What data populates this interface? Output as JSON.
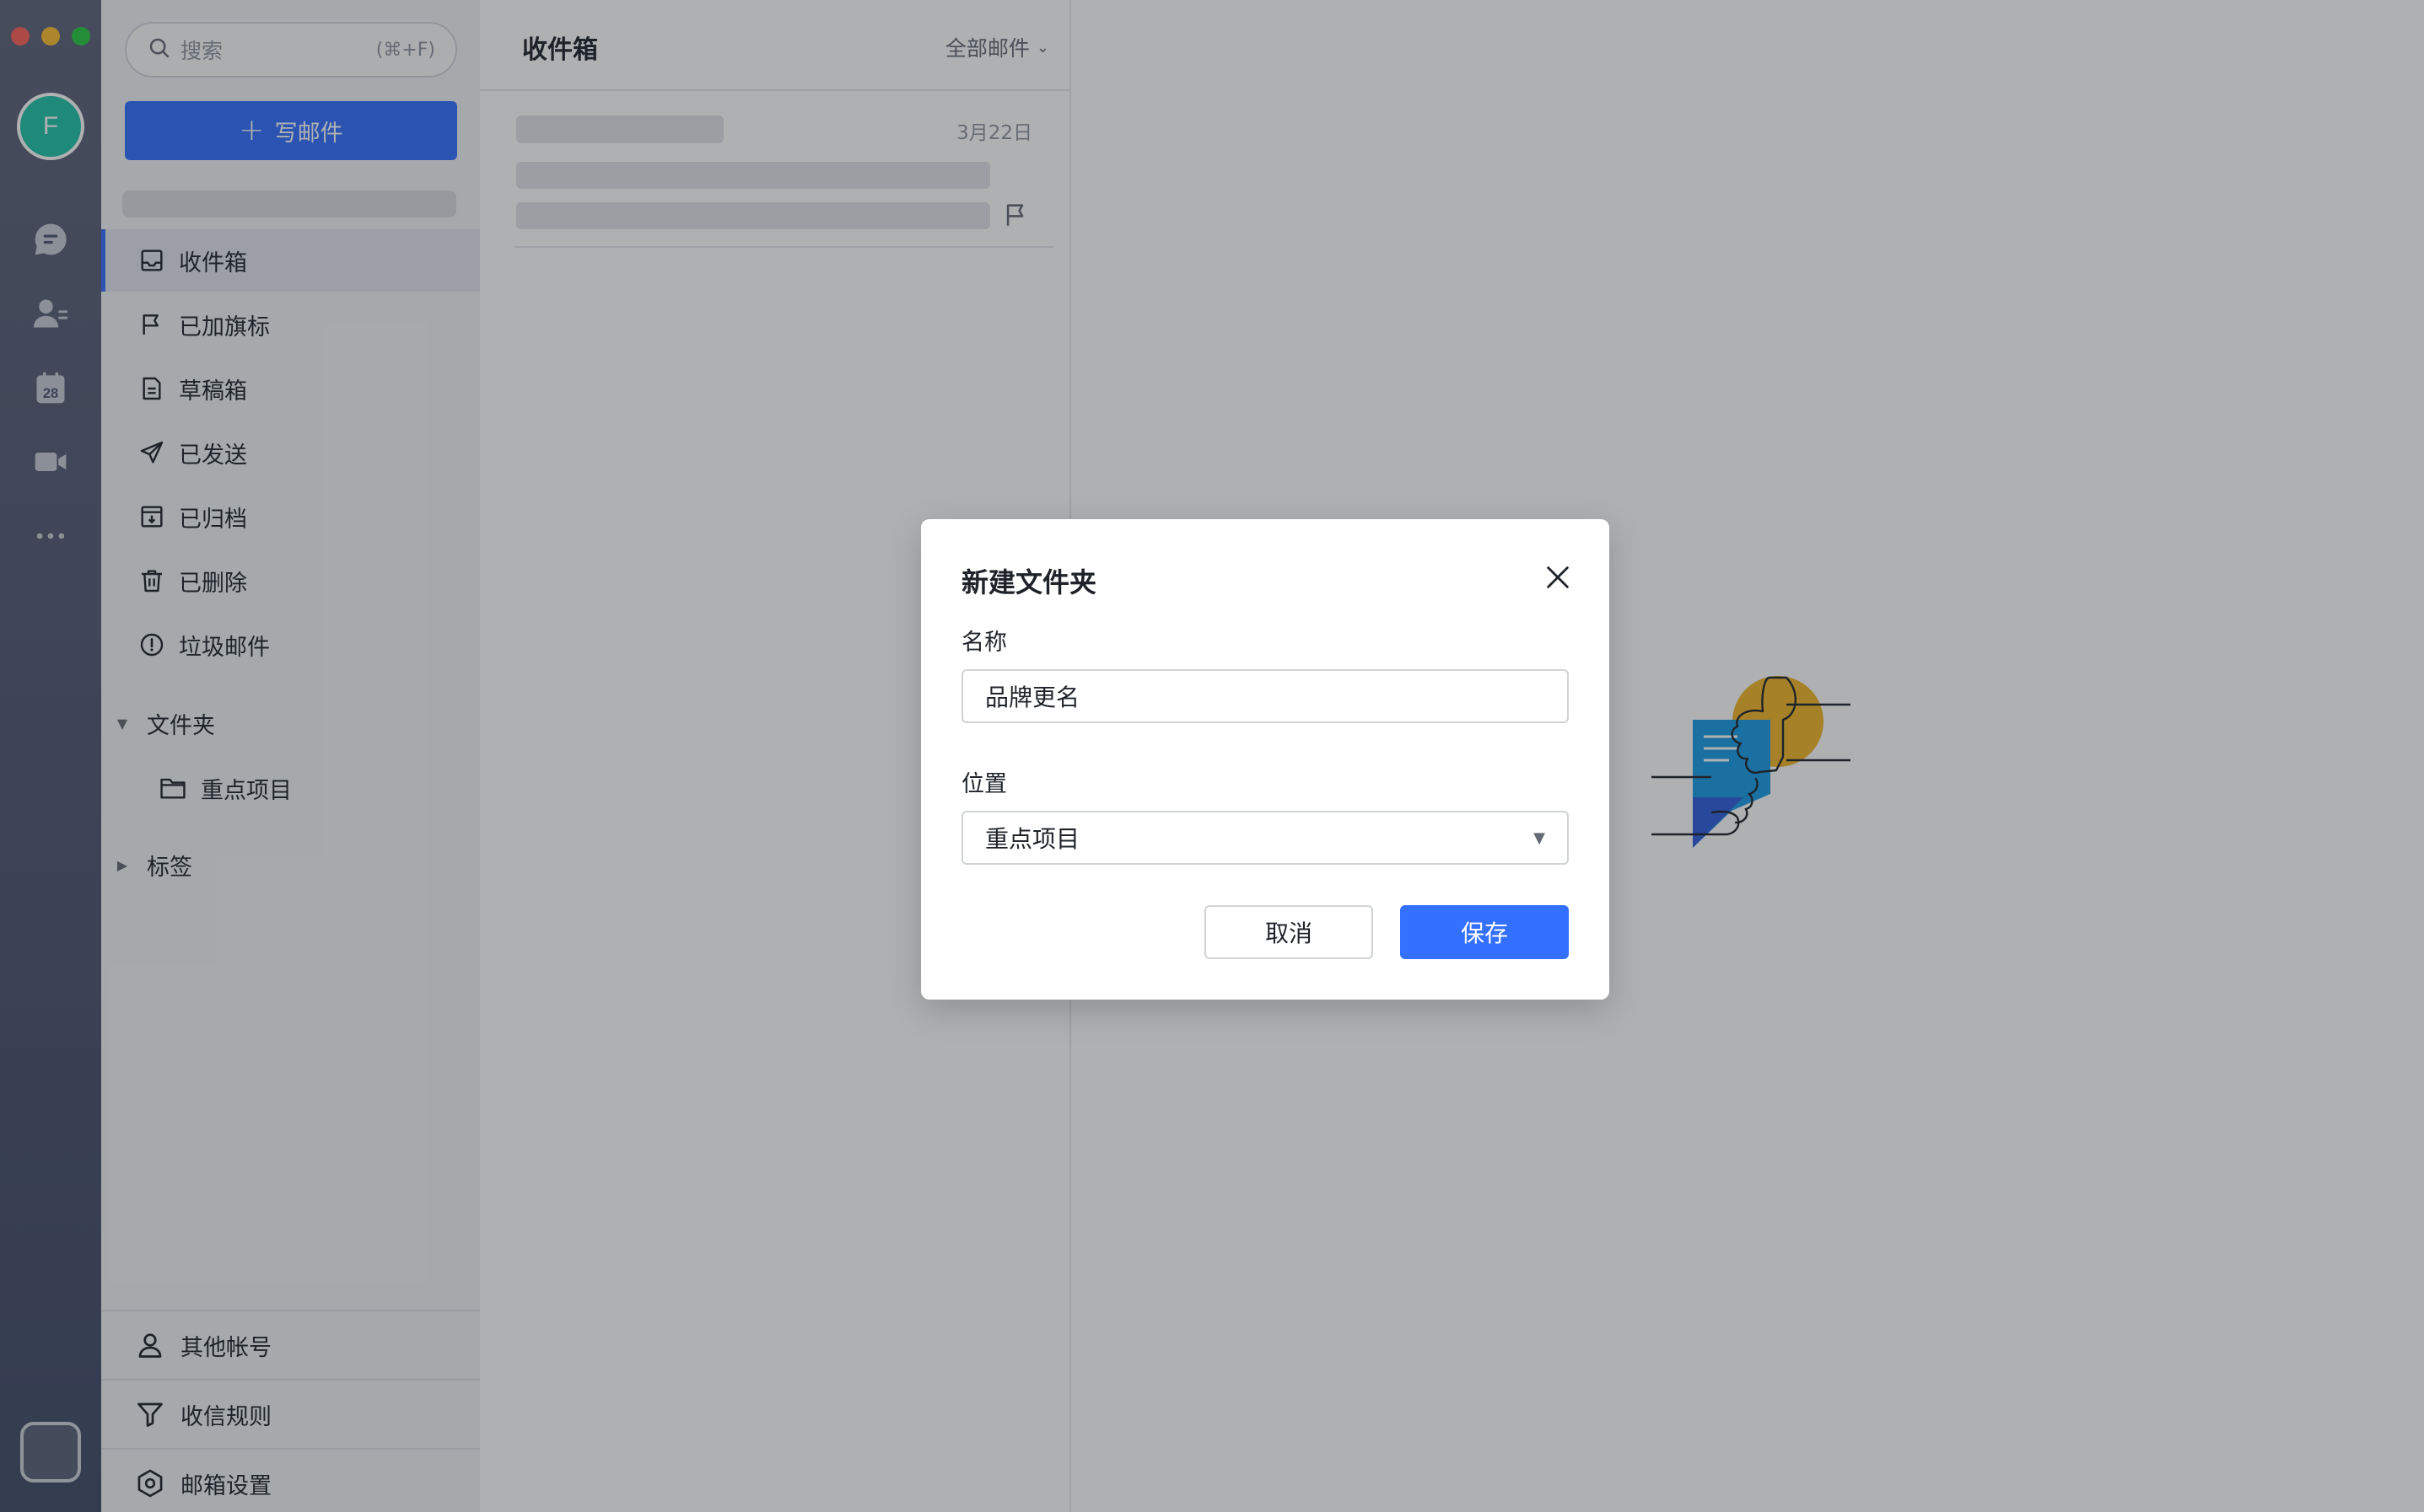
{
  "rail": {
    "avatar_letter": "F",
    "calendar_day": "28"
  },
  "sidebar": {
    "search_placeholder": "搜索",
    "search_shortcut": "(⌘+F)",
    "compose_label": "写邮件",
    "nav": [
      {
        "label": "收件箱",
        "icon": "inbox-icon",
        "active": true
      },
      {
        "label": "已加旗标",
        "icon": "flag-icon"
      },
      {
        "label": "草稿箱",
        "icon": "draft-icon"
      },
      {
        "label": "已发送",
        "icon": "send-icon"
      },
      {
        "label": "已归档",
        "icon": "archive-icon"
      },
      {
        "label": "已删除",
        "icon": "trash-icon"
      },
      {
        "label": "垃圾邮件",
        "icon": "spam-icon"
      }
    ],
    "folders_label": "文件夹",
    "folders": [
      {
        "label": "重点项目",
        "icon": "folder-icon"
      }
    ],
    "tags_label": "标签",
    "bottom": [
      {
        "label": "其他帐号",
        "icon": "user-icon"
      },
      {
        "label": "收信规则",
        "icon": "filter-icon"
      },
      {
        "label": "邮箱设置",
        "icon": "settings-icon"
      }
    ]
  },
  "list": {
    "title": "收件箱",
    "filter": "全部邮件",
    "mail_date": "3月22日"
  },
  "dialog": {
    "title": "新建文件夹",
    "name_label": "名称",
    "name_value": "品牌更名",
    "location_label": "位置",
    "location_value": "重点项目",
    "cancel": "取消",
    "save": "保存"
  },
  "colors": {
    "accent": "#3370ff",
    "avatar": "#20c4a6"
  }
}
